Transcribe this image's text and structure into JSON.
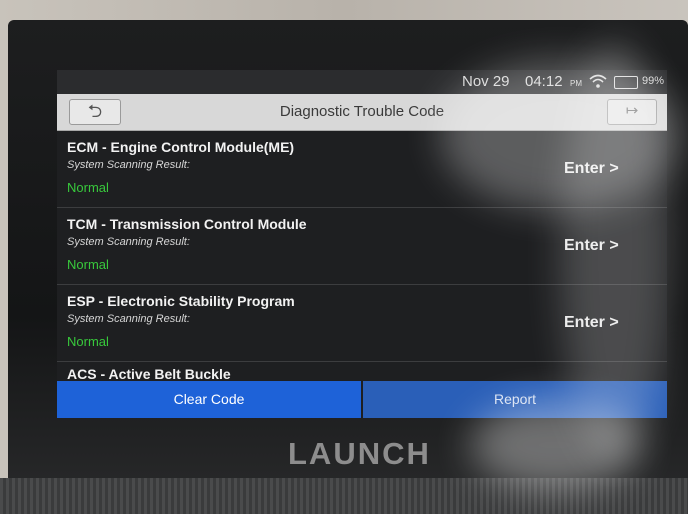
{
  "status": {
    "date": "Nov 29",
    "time": "04:12",
    "ampm": "PM",
    "battery": "99%"
  },
  "header": {
    "back_icon": "⮌",
    "title": "Diagnostic Trouble Code",
    "exit_icon": "↦"
  },
  "modules": [
    {
      "name": "ECM - Engine Control Module(ME)",
      "label": "System Scanning Result:",
      "status": "Normal",
      "action": "Enter >"
    },
    {
      "name": "TCM - Transmission Control Module",
      "label": "System Scanning Result:",
      "status": "Normal",
      "action": "Enter >"
    },
    {
      "name": "ESP - Electronic Stability Program",
      "label": "System Scanning Result:",
      "status": "Normal",
      "action": "Enter >"
    },
    {
      "name": "ACS - Active Belt Buckle"
    }
  ],
  "buttons": {
    "clear": "Clear Code",
    "report": "Report"
  },
  "device": {
    "brand": "LAUNCH"
  },
  "colors": {
    "normal_status": "#38c93c",
    "primary_button": "#1e62d8",
    "titlebar": "#d8d8d8"
  }
}
